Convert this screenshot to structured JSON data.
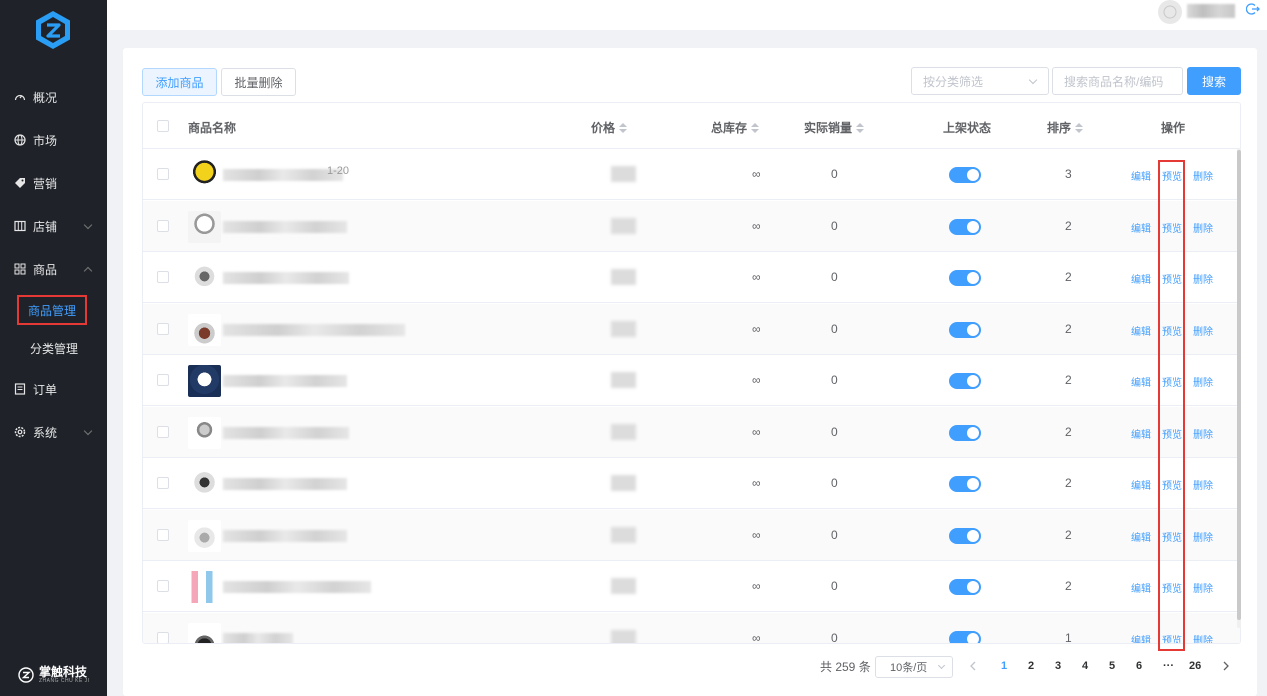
{
  "sidebar": {
    "items": [
      {
        "label": "概况",
        "icon": "dashboard-icon"
      },
      {
        "label": "市场",
        "icon": "globe-icon"
      },
      {
        "label": "营销",
        "icon": "tag-icon"
      },
      {
        "label": "店铺",
        "icon": "store-icon"
      },
      {
        "label": "商品",
        "icon": "grid-icon"
      },
      {
        "label": "订单",
        "icon": "order-icon"
      },
      {
        "label": "系统",
        "icon": "settings-icon"
      }
    ],
    "sub_items": [
      {
        "label": "商品管理",
        "active": true
      },
      {
        "label": "分类管理",
        "active": false
      }
    ],
    "brand_name": "掌触科技",
    "brand_sub": "ZHANG CHU KE JI"
  },
  "toolbar": {
    "add_label": "添加商品",
    "batch_delete_label": "批量删除",
    "category_placeholder": "按分类筛选",
    "search_placeholder": "搜索商品名称/编码",
    "search_label": "搜索"
  },
  "table": {
    "headers": {
      "name": "商品名称",
      "price": "价格",
      "stock": "总库存",
      "sales": "实际销量",
      "status": "上架状态",
      "sort": "排序",
      "ops": "操作"
    },
    "rows": [
      {
        "stock": "∞",
        "sales": "0",
        "sort": "3",
        "on_shelf": true,
        "name_suffix": "1-20"
      },
      {
        "stock": "∞",
        "sales": "0",
        "sort": "2",
        "on_shelf": true,
        "name_suffix": ""
      },
      {
        "stock": "∞",
        "sales": "0",
        "sort": "2",
        "on_shelf": true,
        "name_suffix": ""
      },
      {
        "stock": "∞",
        "sales": "0",
        "sort": "2",
        "on_shelf": true,
        "name_suffix": ""
      },
      {
        "stock": "∞",
        "sales": "0",
        "sort": "2",
        "on_shelf": true,
        "name_suffix": ""
      },
      {
        "stock": "∞",
        "sales": "0",
        "sort": "2",
        "on_shelf": true,
        "name_suffix": ""
      },
      {
        "stock": "∞",
        "sales": "0",
        "sort": "2",
        "on_shelf": true,
        "name_suffix": ""
      },
      {
        "stock": "∞",
        "sales": "0",
        "sort": "2",
        "on_shelf": true,
        "name_suffix": ""
      },
      {
        "stock": "∞",
        "sales": "0",
        "sort": "2",
        "on_shelf": true,
        "name_suffix": ""
      },
      {
        "stock": "∞",
        "sales": "0",
        "sort": "1",
        "on_shelf": true,
        "name_suffix": ""
      }
    ],
    "op_edit": "编辑",
    "op_preview": "预览",
    "op_delete": "删除"
  },
  "pagination": {
    "total_text": "共 259 条",
    "page_size": "10条/页",
    "pages": [
      "1",
      "2",
      "3",
      "4",
      "5",
      "6",
      "···",
      "26"
    ],
    "current": "1"
  },
  "colors": {
    "accent": "#409eff",
    "sidebar_bg": "#1f2329",
    "highlight": "#e53935"
  }
}
